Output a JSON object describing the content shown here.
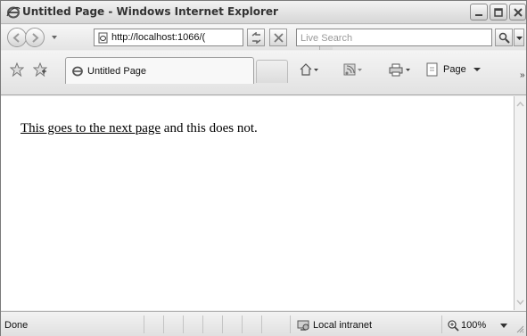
{
  "window": {
    "title": "Untitled Page - Windows Internet Explorer"
  },
  "address_bar": {
    "url": "http://localhost:1066/(",
    "search_placeholder": "Live Search"
  },
  "tab": {
    "label": "Untitled Page"
  },
  "command_bar": {
    "page_label": "Page",
    "more_label": "»"
  },
  "content": {
    "link_text": "This goes to the next page",
    "trailing_text": " and this does not."
  },
  "status_bar": {
    "status": "Done",
    "zone": "Local intranet",
    "zoom": "100%"
  },
  "colors": {
    "chrome": "#eeeeee",
    "content_bg": "#ffffff",
    "text": "#000000"
  },
  "icons": [
    "ie-logo-icon",
    "minimize-icon",
    "maximize-icon",
    "close-icon",
    "back-arrow-icon",
    "forward-arrow-icon",
    "page-icon",
    "refresh-icon",
    "stop-icon",
    "search-icon",
    "star-icon",
    "add-favorite-icon",
    "home-icon",
    "feeds-icon",
    "print-icon",
    "page-menu-icon",
    "intranet-icon",
    "zoom-icon"
  ]
}
